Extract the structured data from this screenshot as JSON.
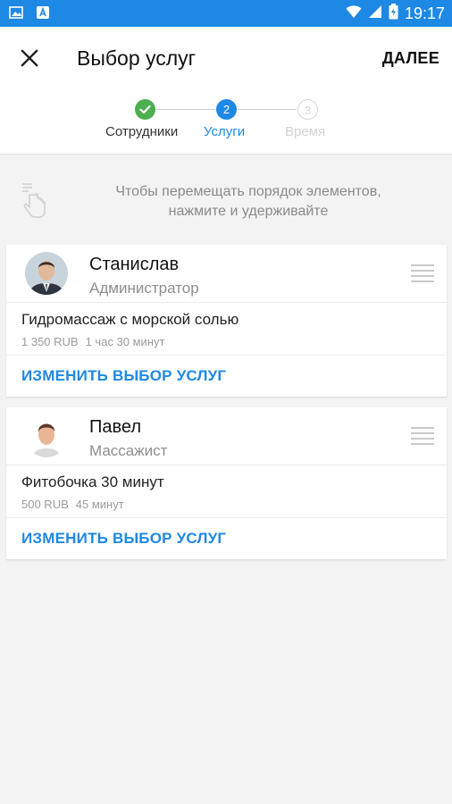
{
  "status_bar": {
    "time": "19:17",
    "icons": [
      "image-icon",
      "app-icon",
      "wifi-icon",
      "signal-icon",
      "battery-icon"
    ]
  },
  "app_bar": {
    "title": "Выбор услуг",
    "next_label": "ДАЛЕЕ"
  },
  "stepper": {
    "steps": [
      {
        "label": "Сотрудники",
        "number": "",
        "state": "done"
      },
      {
        "label": "Услуги",
        "number": "2",
        "state": "active"
      },
      {
        "label": "Время",
        "number": "3",
        "state": "inactive"
      }
    ]
  },
  "hint": {
    "line1": "Чтобы перемещать порядок элементов,",
    "line2": "нажмите и удерживайте"
  },
  "cards": [
    {
      "name": "Станислав",
      "role": "Администратор",
      "service": {
        "name": "Гидромассаж с морской солью",
        "price": "1 350 RUB",
        "duration": "1 час 30 минут"
      },
      "change_label": "ИЗМЕНИТЬ ВЫБОР УСЛУГ"
    },
    {
      "name": "Павел",
      "role": "Массажист",
      "service": {
        "name": "Фитобочка 30 минут",
        "price": "500 RUB",
        "duration": "45 минут"
      },
      "change_label": "ИЗМЕНИТЬ ВЫБОР УСЛУГ"
    }
  ],
  "colors": {
    "accent": "#1e88e5",
    "done": "#4caf50",
    "inactive": "#d6d6d6",
    "background": "#f3f3f3"
  }
}
